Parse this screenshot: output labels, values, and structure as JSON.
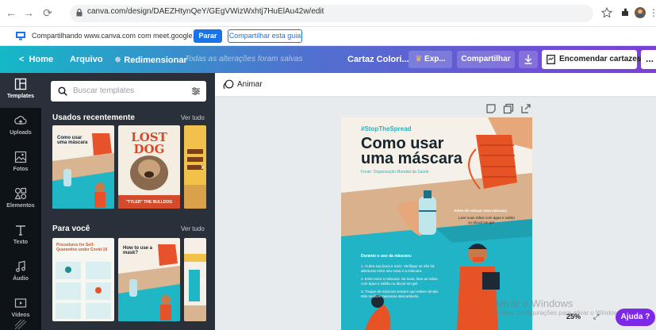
{
  "browser": {
    "url": "canva.com/design/DAEZHtynQeY/GEgVWizWxhtj7HuElAu42w/edit"
  },
  "sharebar": {
    "text": "Compartilhando www.canva.com com meet.google.com",
    "stop_label": "Parar",
    "share_tab_label": "Compartilhar esta guia"
  },
  "topbar": {
    "home": "Home",
    "file": "Arquivo",
    "resize": "Redimensionar",
    "saved_status": "Todas as alterações foram salvas",
    "design_title": "Cartaz Colori...",
    "export": "Exp...",
    "share": "Compartilhar",
    "order": "Encomendar cartazes",
    "more": "..."
  },
  "rail": {
    "templates": "Templates",
    "uploads": "Uploads",
    "photos": "Fotos",
    "elements": "Elementos",
    "text": "Texto",
    "audio": "Áudio",
    "videos": "Vídeos"
  },
  "panel": {
    "search_placeholder": "Buscar templates",
    "recent_title": "Usados recentemente",
    "recent_link": "Ver tudo",
    "foryou_title": "Para você",
    "foryou_link": "Ver tudo",
    "thumb1_title": "Como usar uma máscara",
    "thumb2_title": "LOST DOG",
    "thumb2_caption": "\"TYLER\" THE BULLDOG",
    "thumb3_title": "How to use a mask?",
    "thumb4_title": "Procedures for Self-Quarantine under Covid-19"
  },
  "editor": {
    "animate": "Animar",
    "zoom": "25%",
    "help": "Ajuda ?"
  },
  "poster": {
    "hashtag": "#StopTheSpread",
    "title_line1": "Como usar",
    "title_line2": "uma máscara",
    "source": "Fonte: Organização Mundial da Saúde",
    "before_title": "Antes de colocar uma máscara:",
    "before_text1": "Lave suas mãos com água e sabão",
    "before_text2": "ou álcool em gel",
    "during_title": "Durante o uso da máscara:",
    "during_1": "1. Cubra sua boca e nariz. Verifique se não há",
    "during_1b": "aberturas entre seu rosto e a máscara.",
    "during_2": "2. Evite tocar a máscara. Se tocar, lave as mãos",
    "during_2b": "com água e sabão ou álcool em gel.",
    "during_3": "3. Troque de máscara sempre que estiver úmida.",
    "during_3b": "Não reutilize máscaras descartáveis."
  },
  "watermark": {
    "line1": "Ativar o Windows",
    "line2": "Acesse Configurações para ativar o Windows."
  },
  "colors": {
    "canva_gradient_start": "#15b8c7",
    "canva_gradient_end": "#7b3fd9",
    "rail_bg": "#0e1318",
    "panel_bg": "#293039",
    "help_purple": "#7d2ae8",
    "poster_teal": "#1fb7c5",
    "poster_orange": "#f0612c"
  }
}
